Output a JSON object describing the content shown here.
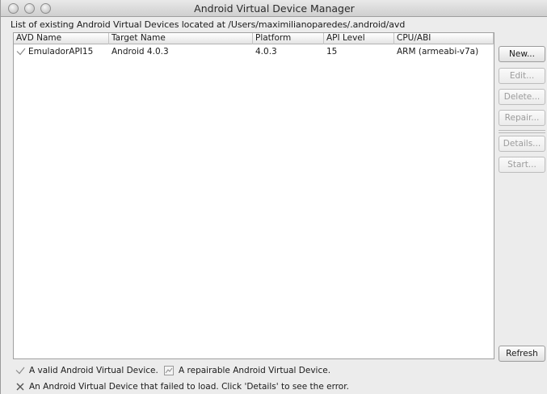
{
  "window": {
    "title": "Android Virtual Device Manager"
  },
  "header": {
    "label": "List of existing Android Virtual Devices located at /Users/maximilianoparedes/.android/avd"
  },
  "table": {
    "columns": [
      "AVD Name",
      "Target Name",
      "Platform",
      "API Level",
      "CPU/ABI"
    ],
    "rows": [
      {
        "status": "valid",
        "name": "EmuladorAPI15",
        "target": "Android 4.0.3",
        "platform": "4.0.3",
        "api": "15",
        "abi": "ARM (armeabi-v7a)"
      }
    ]
  },
  "buttons": {
    "new": "New...",
    "edit": "Edit...",
    "delete": "Delete...",
    "repair": "Repair...",
    "details": "Details...",
    "start": "Start...",
    "refresh": "Refresh"
  },
  "legend": {
    "valid_text": "A valid Android Virtual Device.",
    "repairable_text": "A repairable Android Virtual Device.",
    "failed_text": "An Android Virtual Device that failed to load. Click 'Details' to see the error."
  },
  "icons": {
    "valid": "checkmark-icon",
    "repairable": "repair-icon",
    "failed": "x-icon"
  }
}
